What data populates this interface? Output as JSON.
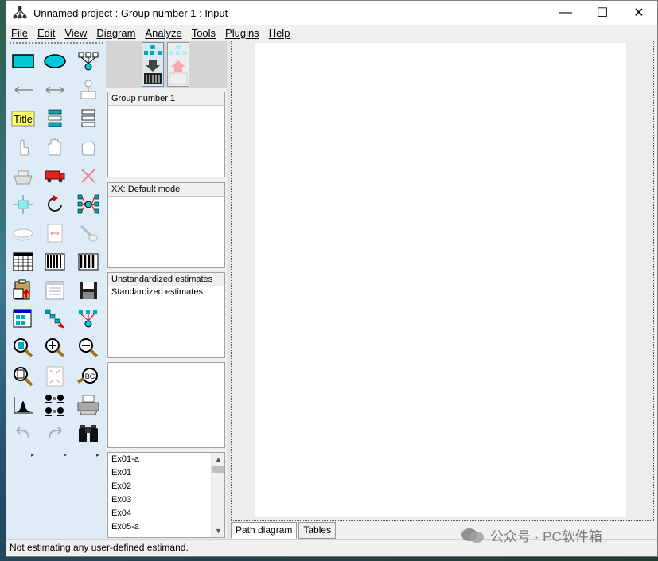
{
  "window": {
    "title": "Unnamed project : Group number 1 : Input",
    "minimize": "—",
    "maximize": "☐",
    "close": "✕"
  },
  "menu": [
    "File",
    "Edit",
    "View",
    "Diagram",
    "Analyze",
    "Tools",
    "Plugins",
    "Help"
  ],
  "toolbox": {
    "title_tool_label": "Title",
    "scroll_arrow": "▸"
  },
  "panels": {
    "groups": {
      "header": "Group number 1"
    },
    "models": {
      "header": "XX: Default model"
    },
    "estimates": {
      "items": [
        "Unstandardized estimates",
        "Standardized estimates"
      ]
    }
  },
  "files": [
    "Ex01-a",
    "Ex01",
    "Ex02",
    "Ex03",
    "Ex04",
    "Ex05-a"
  ],
  "tabs": [
    "Path diagram",
    "Tables"
  ],
  "status": "Not estimating any user-defined estimand.",
  "watermark": "公众号 · PC软件箱",
  "colors": {
    "toolbox_bg": "#ddecf6",
    "accent_cyan": "#00c8d7",
    "title_yellow": "#ffff66"
  }
}
